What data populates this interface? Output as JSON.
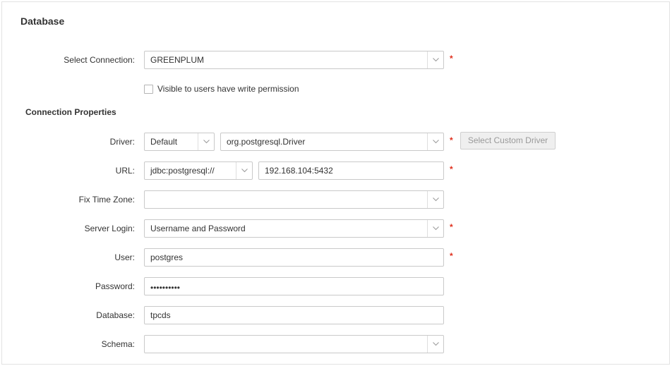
{
  "section_title": "Database",
  "connection_properties_title": "Connection Properties",
  "select_connection": {
    "label": "Select Connection:",
    "value": "GREENPLUM",
    "required": "*"
  },
  "visible_checkbox": {
    "label": "Visible to users have write permission",
    "checked": false
  },
  "driver": {
    "label": "Driver:",
    "type_value": "Default",
    "class_value": "org.postgresql.Driver",
    "required": "*",
    "custom_button": "Select Custom Driver"
  },
  "url": {
    "label": "URL:",
    "prefix_value": "jdbc:postgresql://",
    "host_value": "192.168.104:5432",
    "required": "*"
  },
  "fix_time_zone": {
    "label": "Fix Time Zone:",
    "value": ""
  },
  "server_login": {
    "label": "Server Login:",
    "value": "Username and Password",
    "required": "*"
  },
  "user": {
    "label": "User:",
    "value": "postgres",
    "required": "*"
  },
  "password": {
    "label": "Password:",
    "value": "••••••••••"
  },
  "database": {
    "label": "Database:",
    "value": "tpcds"
  },
  "schema": {
    "label": "Schema:",
    "value": ""
  },
  "colors": {
    "required": "#e0301e",
    "border": "#c9c9c9",
    "disabled_text": "#9a9a9a"
  }
}
